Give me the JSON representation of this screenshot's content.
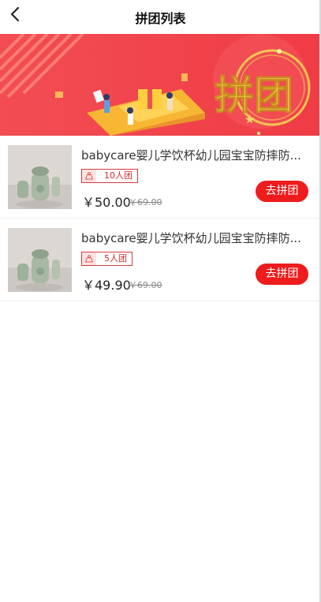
{
  "header": {
    "title": "拼团列表",
    "back_icon": "chevron-left-icon"
  },
  "banner": {
    "text": "拼团",
    "colors": {
      "background": "#f2454c",
      "gold": "#f5c451"
    }
  },
  "products": [
    {
      "name": "babycare婴儿学饮杯幼儿园宝宝防摔防...",
      "group_size": "10人团",
      "price": "￥50.00",
      "original_price": "￥69.00",
      "button": "去拼团"
    },
    {
      "name": "babycare婴儿学饮杯幼儿园宝宝防摔防...",
      "group_size": "5人团",
      "price": "￥49.90",
      "original_price": "￥69.00",
      "button": "去拼团"
    }
  ],
  "colors": {
    "accent": "#ee1c1c",
    "tag_border": "#d93a3a"
  }
}
